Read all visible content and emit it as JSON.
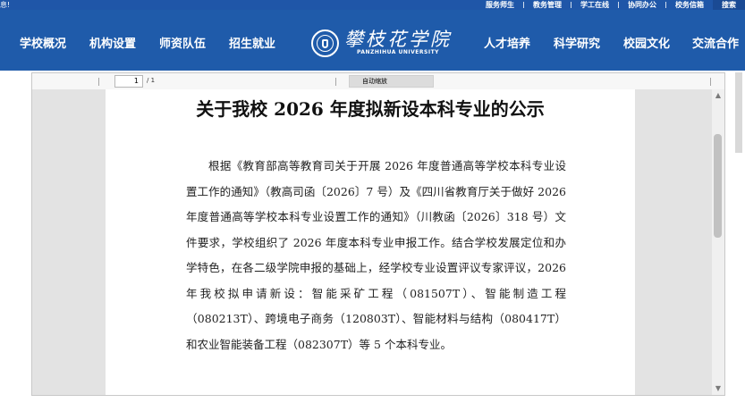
{
  "top_bar": {
    "left_fragment": "息!",
    "links": [
      "服务师生",
      "教务管理",
      "学工在线",
      "协同办公",
      "校务信箱"
    ],
    "search_label": "搜索"
  },
  "nav": {
    "left_items": [
      "学校概况",
      "机构设置",
      "师资队伍",
      "招生就业"
    ],
    "right_items": [
      "人才培养",
      "科学研究",
      "校园文化",
      "交流合作"
    ]
  },
  "logo": {
    "name_cn": "攀枝花学院",
    "name_en": "PANZHIHUA UNIVERSITY",
    "seal_icon": "university-seal-icon"
  },
  "viewer": {
    "page_current": "1",
    "page_total": "/ 1",
    "zoom_label": "自动缩放",
    "scroll_up_icon": "▲",
    "scroll_down_icon": "▼"
  },
  "document": {
    "title": "关于我校 2026 年度拟新设本科专业的公示",
    "body": "根据《教育部高等教育司关于开展 2026 年度普通高等学校本科专业设置工作的通知》（教高司函〔2026〕7 号）及《四川省教育厅关于做好 2026 年度普通高等学校本科专业设置工作的通知》（川教函〔2026〕318 号）文件要求，学校组织了 2026 年度本科专业申报工作。结合学校发展定位和办学特色，在各二级学院申报的基础上，经学校专业设置评议专家评议，2026 年我校拟申请新设：智能采矿工程（081507T）、智能制造工程（080213T）、跨境电子商务（120803T）、智能材料与结构（080417T）和农业智能装备工程（082307T）等 5 个本科专业。"
  },
  "colors": {
    "brand_blue": "#1f5baa",
    "top_bar_blue": "#1f56a8"
  }
}
